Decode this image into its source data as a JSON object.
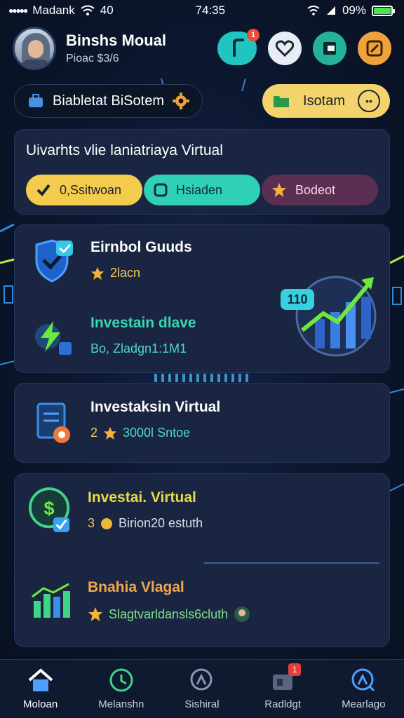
{
  "status_bar": {
    "carrier": "Madank",
    "signal_text": "40",
    "time": "74:35",
    "battery": "09%",
    "battery_color": "#4ee44e"
  },
  "header": {
    "user_name": "Binshs Moual",
    "user_sub": "Pioac $3/6",
    "notification_count": "1",
    "icons": [
      "swap-icon",
      "heart-icon",
      "wallet-icon",
      "edit-icon"
    ]
  },
  "chips": {
    "left_label": "Biabletat BiSotem",
    "right_label": "Isotam"
  },
  "filter": {
    "title": "Uivarhts vlie laniatriaya Virtual",
    "buttons": [
      {
        "label": "0,Ssitwoan",
        "color": "#f3cc4d"
      },
      {
        "label": "Hsiaden",
        "color": "#2fcfb8"
      },
      {
        "label": "Bodeot",
        "color": "#5a2f52"
      }
    ]
  },
  "investments": {
    "card1": {
      "item1": {
        "title": "Eirnbol Guuds",
        "sub": "2lacn"
      },
      "item2": {
        "title": "Investain dlave",
        "sub": "Bo, Zladgn1:1M1"
      },
      "chart_badge": "110"
    },
    "card2": {
      "item1": {
        "title": "Investaksin Virtual",
        "sub_num": "2",
        "sub": "3000l Sntoe"
      }
    },
    "card3": {
      "item1": {
        "title": "Investai. Virtual",
        "sub_num": "3",
        "sub": "Birion20 estuth"
      },
      "item2": {
        "title": "Bnahia Vlagal",
        "sub": "Slagtvarldansls6cluth"
      }
    }
  },
  "nav": [
    {
      "label": "Moloan",
      "icon": "home-icon",
      "active": true
    },
    {
      "label": "Melanshn",
      "icon": "clock-icon",
      "active": false
    },
    {
      "label": "Sishiral",
      "icon": "search-person-icon",
      "active": false
    },
    {
      "label": "Radldgt",
      "icon": "shop-icon",
      "active": false,
      "badge": "1"
    },
    {
      "label": "Mearlago",
      "icon": "explore-icon",
      "active": false
    }
  ],
  "colors": {
    "accent_teal": "#2fcfb8",
    "accent_yellow": "#f3cc4d",
    "background": "#0c1730"
  }
}
